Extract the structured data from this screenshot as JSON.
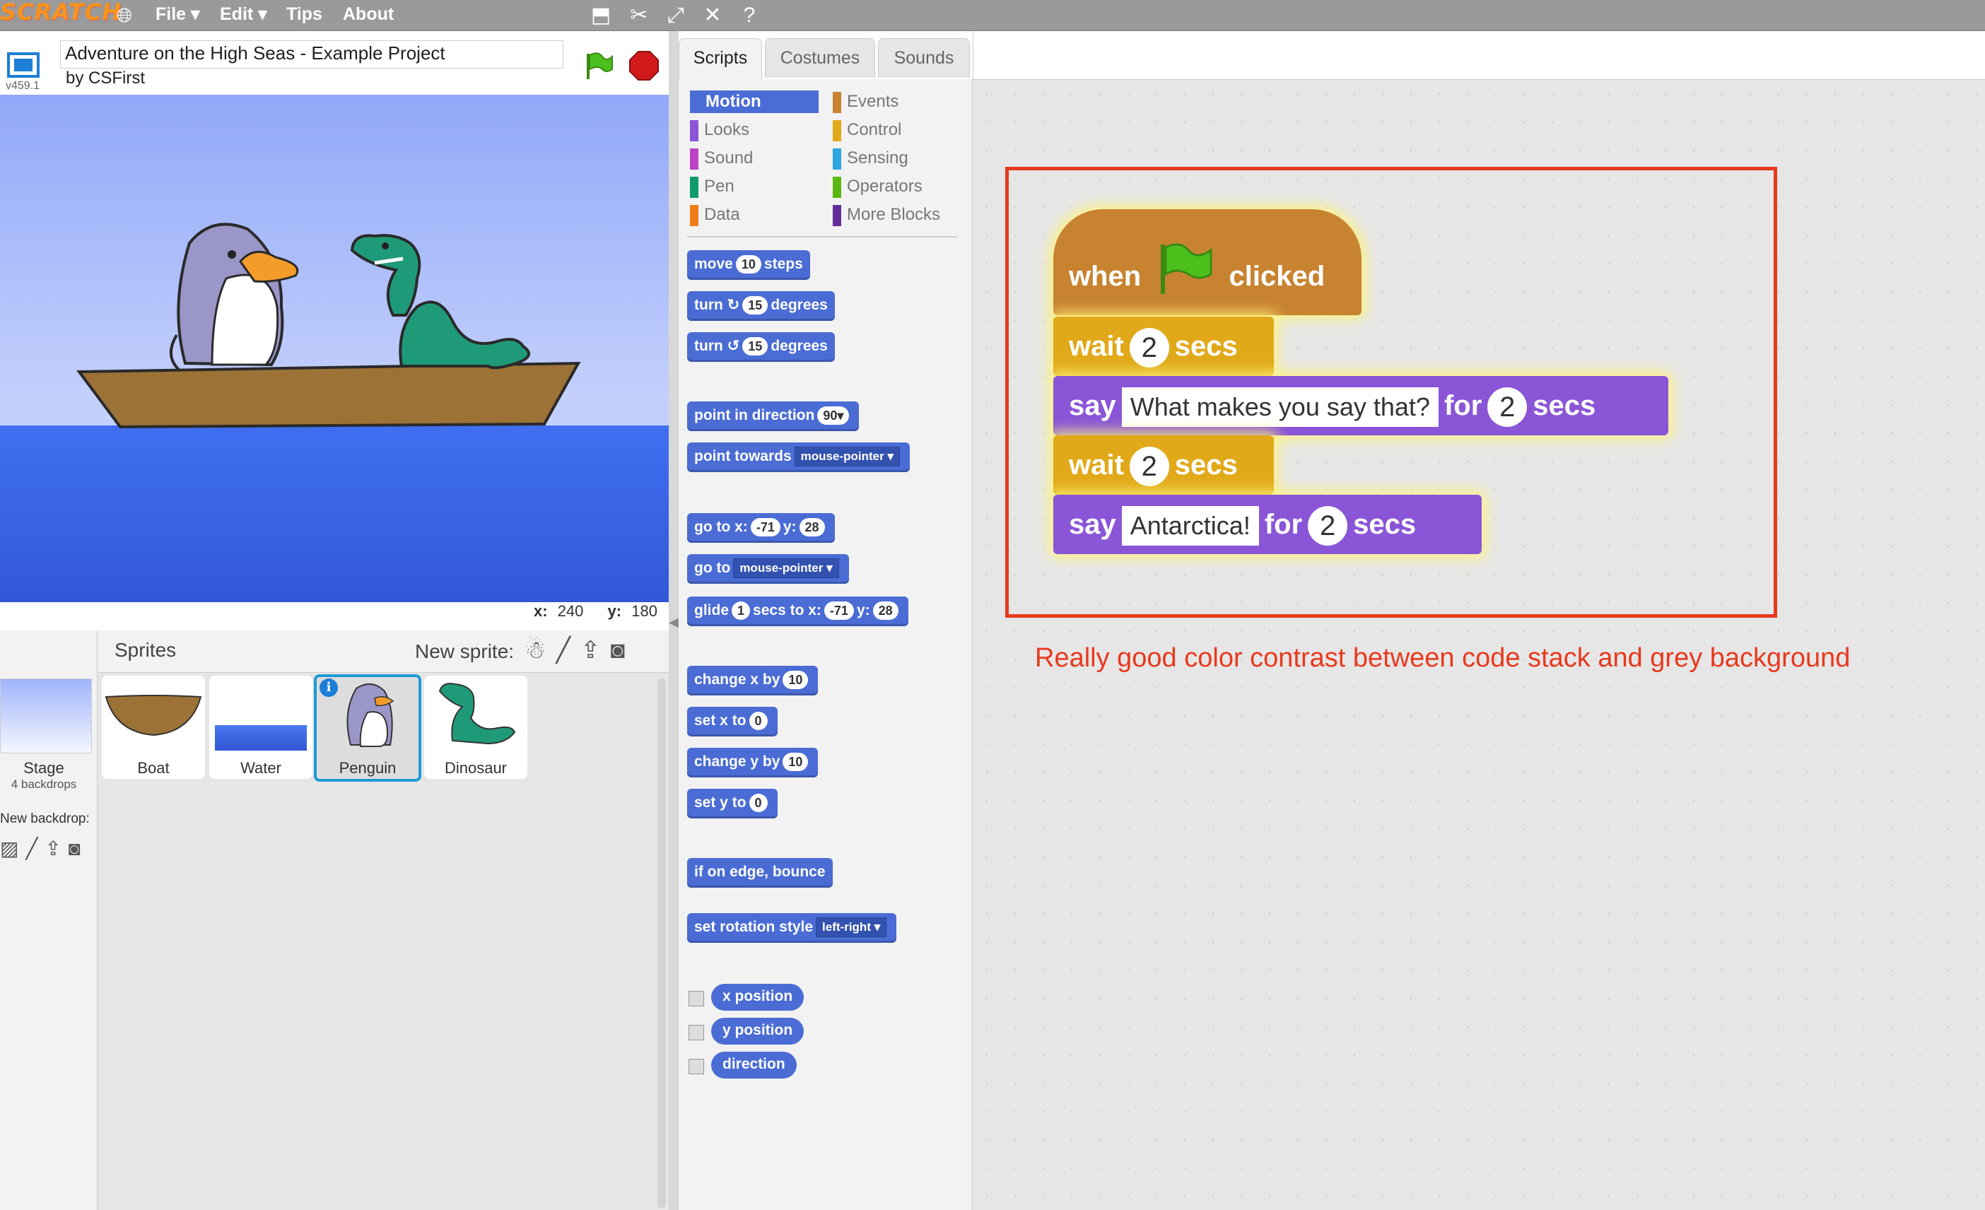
{
  "menubar": {
    "logo": "SCRATCH",
    "file": "File ▾",
    "edit": "Edit ▾",
    "tips": "Tips",
    "about": "About"
  },
  "project": {
    "title": "Adventure on the High Seas - Example Project",
    "author": "by CSFirst",
    "version": "v459.1"
  },
  "stage": {
    "x_label": "x:",
    "x_value": "240",
    "y_label": "y:",
    "y_value": "180"
  },
  "tabs": [
    "Scripts",
    "Costumes",
    "Sounds"
  ],
  "categories": [
    {
      "label": "Motion",
      "color": "#4a6cd4"
    },
    {
      "label": "Looks",
      "color": "#8a55d7"
    },
    {
      "label": "Sound",
      "color": "#bb42c3"
    },
    {
      "label": "Pen",
      "color": "#0e9a6c"
    },
    {
      "label": "Data",
      "color": "#ee7d16"
    },
    {
      "label": "Events",
      "color": "#c88330"
    },
    {
      "label": "Control",
      "color": "#e1a91a"
    },
    {
      "label": "Sensing",
      "color": "#2ca5e2"
    },
    {
      "label": "Operators",
      "color": "#5cb712"
    },
    {
      "label": "More Blocks",
      "color": "#632d99"
    }
  ],
  "palette": {
    "move": [
      "move",
      "10",
      "steps"
    ],
    "turn_cw": [
      "turn",
      "↻",
      "15",
      "degrees"
    ],
    "turn_ccw": [
      "turn",
      "↺",
      "15",
      "degrees"
    ],
    "point_dir": [
      "point in direction",
      "90▾"
    ],
    "point_towards": [
      "point towards",
      "mouse-pointer ▾"
    ],
    "goto_xy": [
      "go to x:",
      "-71",
      "y:",
      "28"
    ],
    "goto": [
      "go to",
      "mouse-pointer ▾"
    ],
    "glide": [
      "glide",
      "1",
      "secs to x:",
      "-71",
      "y:",
      "28"
    ],
    "change_x": [
      "change x by",
      "10"
    ],
    "set_x": [
      "set x to",
      "0"
    ],
    "change_y": [
      "change y by",
      "10"
    ],
    "set_y": [
      "set y to",
      "0"
    ],
    "bounce": "if on edge, bounce",
    "rotation": [
      "set rotation style",
      "left-right ▾"
    ],
    "reporters": [
      "x position",
      "y position",
      "direction"
    ]
  },
  "sprites": {
    "title": "Sprites",
    "new_sprite": "New sprite:",
    "stage_label": "Stage",
    "stage_sub": "4 backdrops",
    "new_backdrop": "New backdrop:",
    "items": [
      "Boat",
      "Water",
      "Penguin",
      "Dinosaur"
    ]
  },
  "script": {
    "hat_when": "when",
    "hat_clicked": "clicked",
    "wait1": [
      "wait",
      "2",
      "secs"
    ],
    "say1": [
      "say",
      "What makes you say that?",
      "for",
      "2",
      "secs"
    ],
    "wait2": [
      "wait",
      "2",
      "secs"
    ],
    "say2": [
      "say",
      "Antarctica!",
      "for",
      "2",
      "secs"
    ]
  },
  "annotation": "Really good color contrast between code stack and grey background",
  "colors": {
    "motion": "#4a6cd4",
    "looks": "#8a55d7",
    "control": "#e1a91a",
    "events": "#c88330",
    "highlight": "#e8391d"
  }
}
